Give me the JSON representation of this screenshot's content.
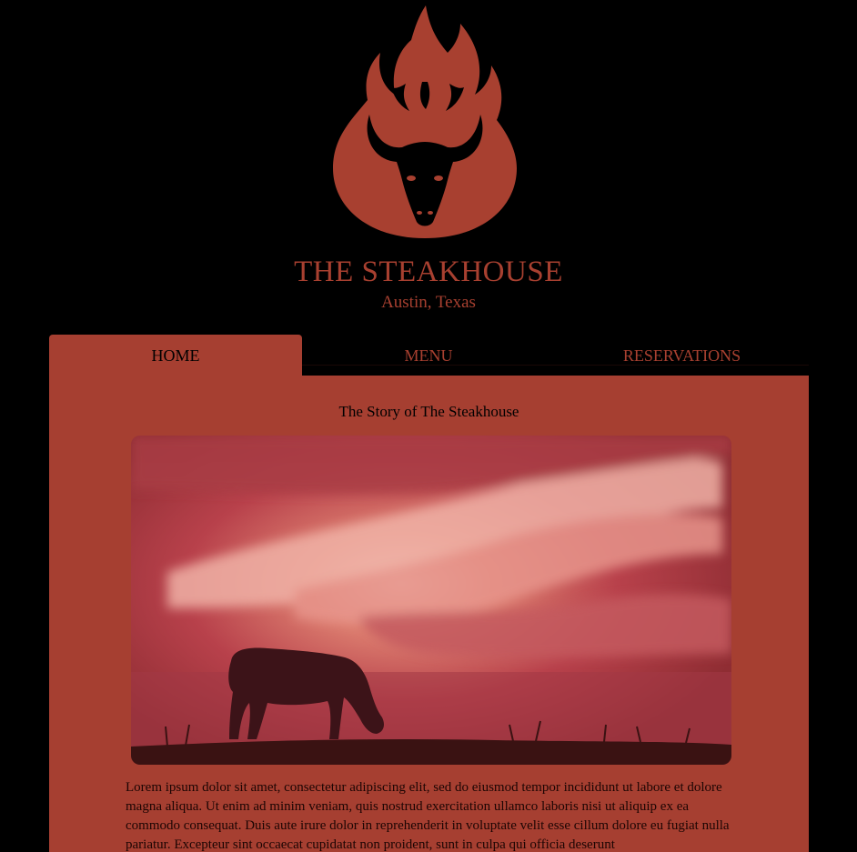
{
  "brand": {
    "title": "THE STEAKHOUSE",
    "subtitle": "Austin, Texas",
    "logo_icon": "flame-bull-logo",
    "accent_color": "#a84030"
  },
  "nav": {
    "tabs": [
      {
        "label": "HOME",
        "active": true
      },
      {
        "label": "MENU",
        "active": false
      },
      {
        "label": "RESERVATIONS",
        "active": false
      }
    ]
  },
  "main": {
    "heading": "The Story of The Steakhouse",
    "hero_image": "cow-grazing-at-sunset",
    "body_text": "Lorem ipsum dolor sit amet, consectetur adipiscing elit, sed do eiusmod tempor incididunt ut labore et dolore magna aliqua. Ut enim ad minim veniam, quis nostrud exercitation ullamco laboris nisi ut aliquip ex ea commodo consequat. Duis aute irure dolor in reprehenderit in voluptate velit esse cillum dolore eu fugiat nulla pariatur. Excepteur sint occaecat cupidatat non proident, sunt in culpa qui officia deserunt"
  }
}
